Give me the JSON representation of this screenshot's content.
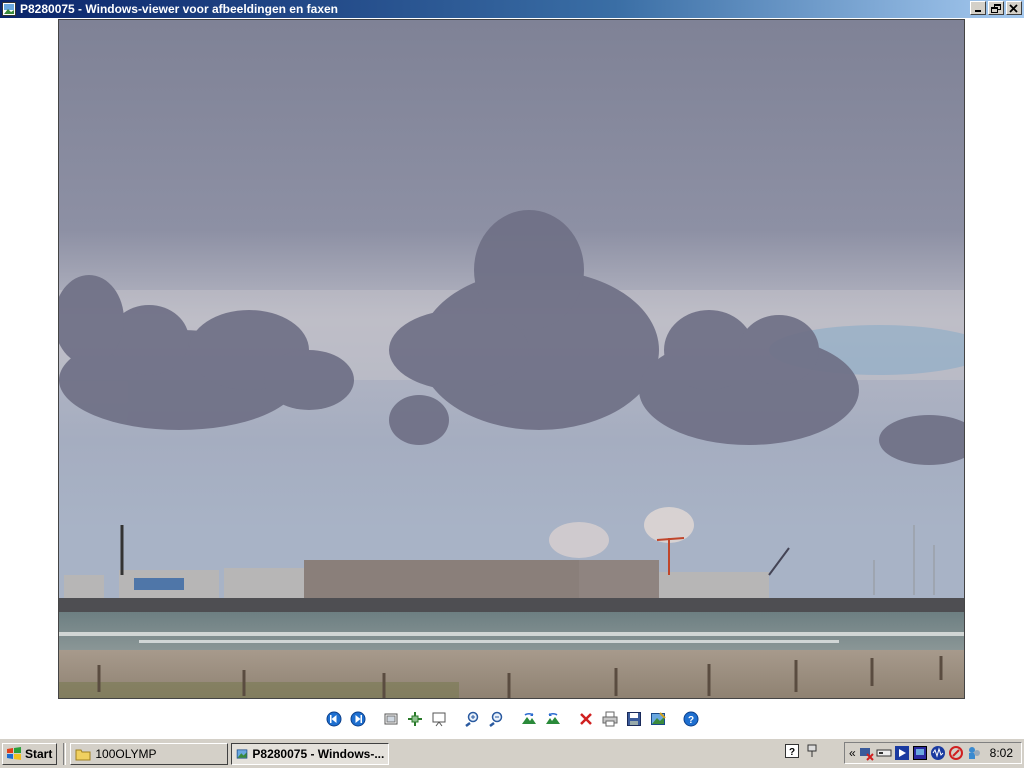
{
  "window": {
    "title": "P8280075 - Windows-viewer voor afbeeldingen en faxen",
    "controls": [
      "minimize",
      "restore",
      "close"
    ]
  },
  "photo": {
    "filename": "P8280075",
    "description_icon": "photo-landscape"
  },
  "toolbar": {
    "buttons": [
      {
        "name": "previous-image-button",
        "icon": "prev-icon",
        "tooltip": "Vorige afbeelding"
      },
      {
        "name": "next-image-button",
        "icon": "next-icon",
        "tooltip": "Volgende afbeelding"
      },
      {
        "name": "best-fit-button",
        "icon": "best-fit-icon",
        "tooltip": "Beste passing"
      },
      {
        "name": "actual-size-button",
        "icon": "actual-size-icon",
        "tooltip": "Werkelijke grootte"
      },
      {
        "name": "slideshow-button",
        "icon": "slideshow-icon",
        "tooltip": "Diavoorstelling"
      },
      {
        "name": "zoom-in-button",
        "icon": "zoom-in-icon",
        "tooltip": "Inzoomen"
      },
      {
        "name": "zoom-out-button",
        "icon": "zoom-out-icon",
        "tooltip": "Uitzoomen"
      },
      {
        "name": "rotate-clockwise-button",
        "icon": "rotate-cw-icon",
        "tooltip": "Rechtsom draaien"
      },
      {
        "name": "rotate-counterclockwise-button",
        "icon": "rotate-ccw-icon",
        "tooltip": "Linksom draaien"
      },
      {
        "name": "delete-button",
        "icon": "delete-icon",
        "tooltip": "Verwijderen"
      },
      {
        "name": "print-button",
        "icon": "print-icon",
        "tooltip": "Afdrukken"
      },
      {
        "name": "save-button",
        "icon": "save-icon",
        "tooltip": "Kopie opslaan"
      },
      {
        "name": "edit-button",
        "icon": "edit-icon",
        "tooltip": "Sluiten en openen voor bewerken"
      },
      {
        "name": "help-button",
        "icon": "help-icon",
        "tooltip": "Help"
      }
    ]
  },
  "taskbar": {
    "start_label": "Start",
    "tasks": [
      {
        "label": "100OLYMP",
        "icon": "folder-icon",
        "active": false
      },
      {
        "label": "P8280075 - Windows-...",
        "icon": "image-viewer-icon",
        "active": true
      }
    ],
    "tray": {
      "expand_label": "«",
      "clock": "8:02"
    }
  },
  "colors": {
    "titlebar_start": "#0a246a",
    "titlebar_end": "#a6caf0",
    "taskbar_bg": "#d4d0c8",
    "sky": "#8a8da0",
    "sea": "#7a8c8e",
    "sand": "#a3978a"
  }
}
